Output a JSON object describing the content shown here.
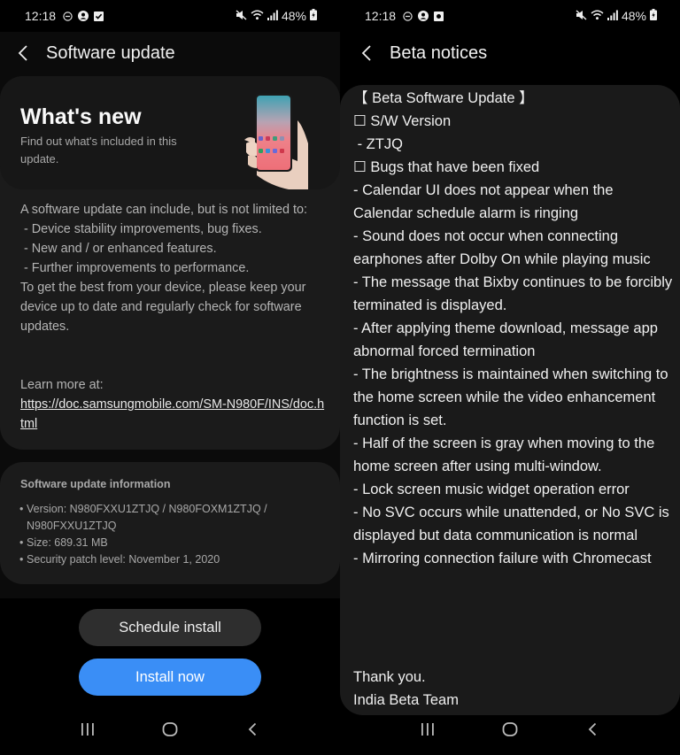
{
  "left": {
    "status_bar": {
      "time": "12:18",
      "left_icons": [
        "do-not-disturb-icon",
        "account-icon",
        "checkbox-notification-icon"
      ],
      "right_icons": [
        "mute-icon",
        "wifi-icon",
        "signal-icon"
      ],
      "battery": "48%"
    },
    "app_bar": {
      "title": "Software update",
      "back_icon": "back-chevron-icon"
    },
    "whats_new": {
      "title": "What's new",
      "subtitle": "Find out what's included in this update."
    },
    "description": {
      "lines": [
        "A software update can include, but is not limited to:",
        " - Device stability improvements, bug fixes.",
        " - New and / or enhanced features.",
        " - Further improvements to performance.",
        "To get the best from your device, please keep your device up to date and regularly check for software updates."
      ]
    },
    "learn_more": {
      "label": "Learn more at:",
      "link": "https://doc.samsungmobile.com/SM-N980F/INS/doc.html"
    },
    "info": {
      "title": "Software update information",
      "items": [
        "Version: N980FXXU1ZTJQ / N980FOXM1ZTJQ / N980FXXU1ZTJQ",
        "Size: 689.31 MB",
        "Security patch level: November 1, 2020"
      ]
    },
    "buttons": {
      "schedule": "Schedule install",
      "install": "Install now"
    },
    "colors": {
      "accent": "#3a8ef6",
      "card": "#1b1b1b",
      "background": "#000000"
    }
  },
  "right": {
    "status_bar": {
      "time": "12:18",
      "left_icons": [
        "do-not-disturb-icon",
        "account-icon",
        "notification-icon"
      ],
      "right_icons": [
        "mute-icon",
        "wifi-icon",
        "signal-icon"
      ],
      "battery": "48%"
    },
    "app_bar": {
      "title": "Beta notices",
      "back_icon": "back-chevron-icon"
    },
    "notice": {
      "lines": [
        "【 Beta Software Update 】",
        "☐ S/W Version",
        " - ZTJQ",
        "☐ Bugs that have been fixed",
        " - Calendar UI does not appear when the Calendar schedule alarm is ringing",
        " - Sound does not occur when connecting earphones after Dolby On while playing music",
        " - The message that Bixby continues to be forcibly terminated is displayed.",
        " - After applying theme download, message app abnormal forced termination",
        " - The brightness is maintained when switching to the home screen while the video enhancement function is set.",
        " - Half of the screen is gray when moving to the home screen after using multi-window.",
        " - Lock screen music widget operation error",
        " - No SVC occurs while unattended, or No SVC is displayed but data communication is normal",
        " - Mirroring connection failure with Chromecast"
      ],
      "closing": [
        "Thank you.",
        "India Beta Team"
      ]
    }
  },
  "nav_bar": {
    "icons": [
      "recent-apps-icon",
      "home-icon",
      "back-icon"
    ]
  }
}
